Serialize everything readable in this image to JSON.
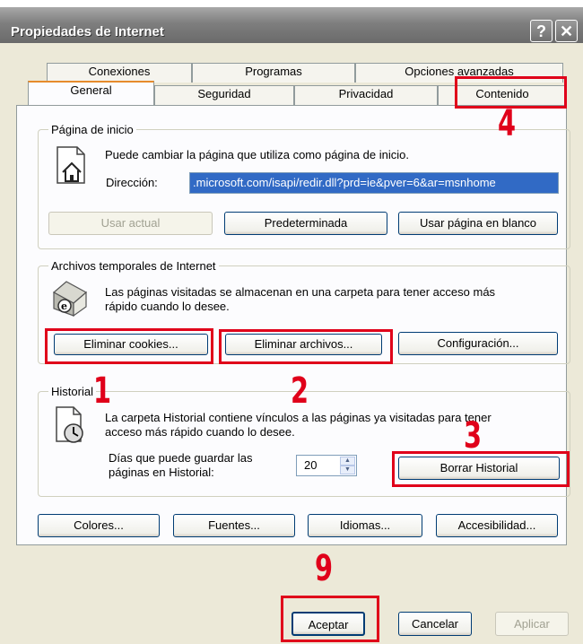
{
  "window": {
    "title": "Propiedades de Internet",
    "help_button": "?",
    "close_button": "✕"
  },
  "tabs": {
    "back_row": [
      "Conexiones",
      "Programas",
      "Opciones avanzadas"
    ],
    "front_row": [
      "General",
      "Seguridad",
      "Privacidad",
      "Contenido"
    ],
    "active": "General"
  },
  "home": {
    "legend": "Página de inicio",
    "description": "Puede cambiar la página que utiliza como página de inicio.",
    "address_label": "Dirección:",
    "address_value": ".microsoft.com/isapi/redir.dll?prd=ie&pver=6&ar=msnhome",
    "btn_use_current": "Usar actual",
    "btn_default": "Predeterminada",
    "btn_blank": "Usar página en blanco"
  },
  "temp_files": {
    "legend": "Archivos temporales de Internet",
    "description_line1": "Las páginas visitadas se almacenan en una carpeta para tener acceso más",
    "description_line2": "rápido cuando lo desee.",
    "btn_delete_cookies": "Eliminar cookies...",
    "btn_delete_files": "Eliminar archivos...",
    "btn_settings": "Configuración..."
  },
  "history": {
    "legend": "Historial",
    "description_line1": "La carpeta Historial contiene vínculos a las páginas ya visitadas para tener",
    "description_line2": "acceso más rápido cuando lo desee.",
    "days_label_line1": "Días que puede guardar las",
    "days_label_line2": "páginas en Historial:",
    "days_value": "20",
    "btn_clear": "Borrar Historial"
  },
  "bottom_buttons": {
    "colors": "Colores...",
    "fonts": "Fuentes...",
    "languages": "Idiomas...",
    "accessibility": "Accesibilidad..."
  },
  "dialog_buttons": {
    "ok": "Aceptar",
    "cancel": "Cancelar",
    "apply": "Aplicar"
  },
  "annotations": {
    "n1": "1",
    "n2": "2",
    "n3": "3",
    "n4": "4",
    "n9": "9"
  },
  "colors": {
    "annotation_red": "#e0001a",
    "selection_blue": "#316ac5",
    "dialog_face": "#ece9d8"
  }
}
